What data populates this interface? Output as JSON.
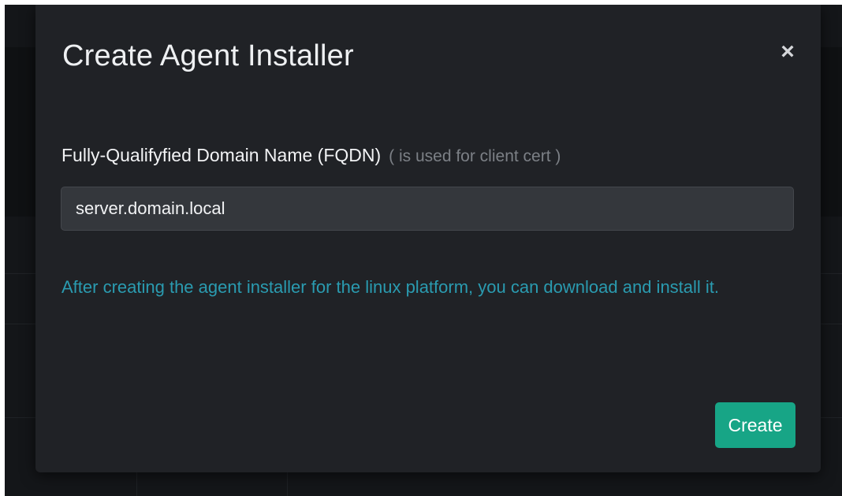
{
  "modal": {
    "title": "Create Agent Installer",
    "close_label": "×",
    "fqdn": {
      "label": "Fully-Qualifyfied Domain Name (FQDN)",
      "hint": "( is used for client cert )",
      "value": "server.domain.local"
    },
    "info": "After creating the agent installer for the linux platform, you can download and install it.",
    "create_label": "Create"
  },
  "colors": {
    "modal_background": "#202226",
    "overlay_background": "#141619",
    "info_text": "#2a9bb0",
    "primary_button": "#17a586",
    "input_background": "#34373c"
  },
  "icons": {
    "close": "close-icon"
  }
}
